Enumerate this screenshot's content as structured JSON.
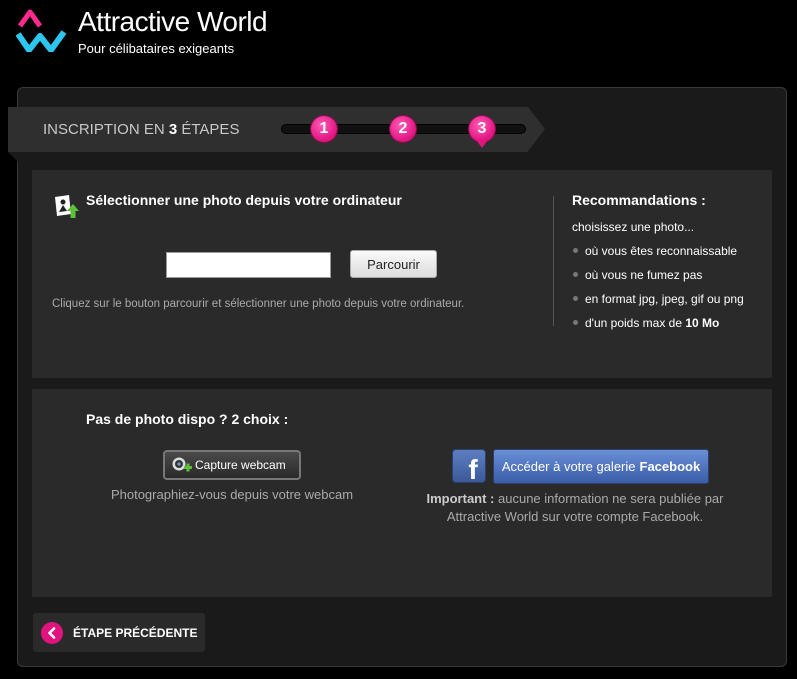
{
  "header": {
    "brand_name": "Attractive World",
    "tagline": "Pour célibataires exigeants"
  },
  "steps": {
    "title_prefix": "INSCRIPTION EN ",
    "title_count": "3",
    "title_suffix": " ÉTAPES",
    "items": [
      "1",
      "2",
      "3"
    ],
    "active": 3
  },
  "upload": {
    "title": "Sélectionner une photo depuis votre ordinateur",
    "file_value": "",
    "browse_label": "Parcourir",
    "hint": "Cliquez sur le bouton parcourir et sélectionner une photo depuis votre ordinateur."
  },
  "recommendations": {
    "title": "Recommandations :",
    "intro": "choisissez une photo...",
    "items": [
      "où vous êtes reconnaissable",
      "où vous ne fumez pas",
      "en format jpg, jpeg, gif ou png"
    ],
    "weight_prefix": "d'un poids max de ",
    "weight_value": "10 Mo"
  },
  "no_photo": {
    "title": "Pas de photo dispo ? 2 choix :",
    "webcam_label": "Capture webcam",
    "webcam_hint": "Photographiez-vous depuis votre webcam",
    "facebook_prefix": "Accéder à votre galerie",
    "facebook_brand": "Facebook",
    "important_label": "Important :",
    "important_text": " aucune information ne sera publiée par Attractive World sur votre compte Facebook."
  },
  "footer": {
    "prev_label": "ÉTAPE PRÉCÉDENTE"
  },
  "colors": {
    "accent": "#e0137f",
    "facebook": "#3b5998",
    "background": "#000000",
    "panel": "#2a2a2a"
  }
}
